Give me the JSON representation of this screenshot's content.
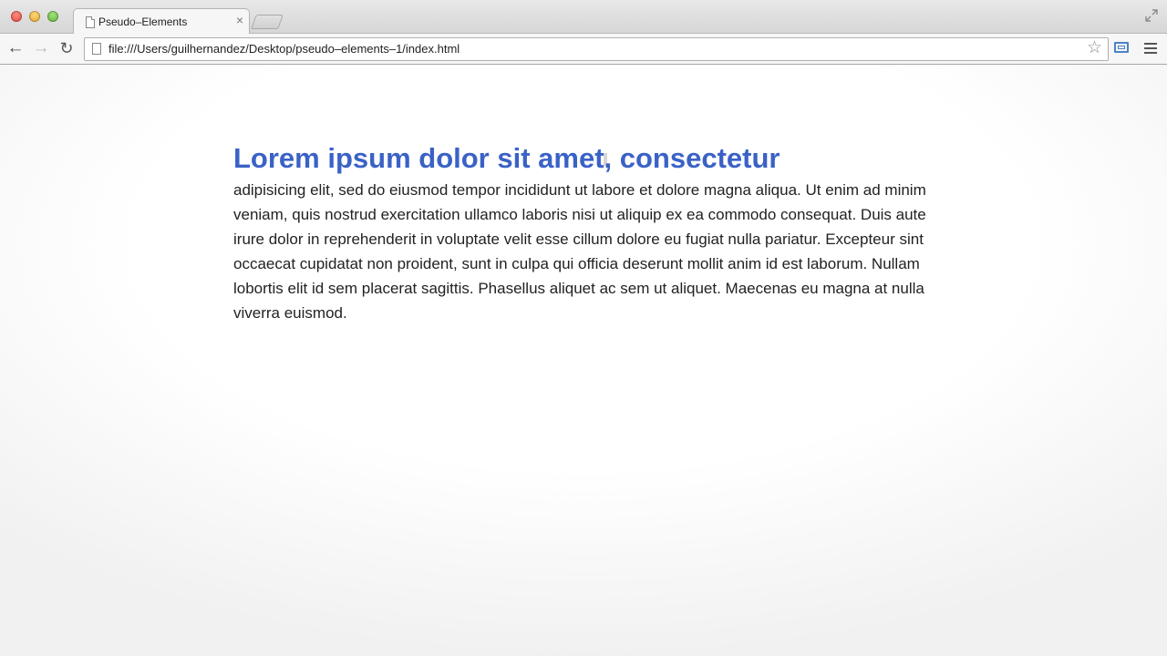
{
  "browser": {
    "tab": {
      "title": "Pseudo–Elements",
      "close_glyph": "×"
    },
    "toolbar": {
      "back_glyph": "←",
      "forward_glyph": "→",
      "reload_glyph": "↻",
      "url": "file:///Users/guilhernandez/Desktop/pseudo–elements–1/index.html",
      "star_glyph": "☆"
    },
    "icons": [
      "close-window-icon",
      "minimize-window-icon",
      "maximize-window-icon",
      "page-icon",
      "fullscreen-icon",
      "back-arrow-icon",
      "forward-arrow-icon",
      "reload-icon",
      "bookmark-star-icon",
      "cast-screen-icon",
      "menu-icon"
    ]
  },
  "page": {
    "headline": "Lorem ipsum dolor sit amet, consectetur",
    "paragraph": "adipisicing elit, sed do eiusmod tempor incididunt ut labore et dolore magna aliqua. Ut enim ad minim veniam, quis nostrud exercitation ullamco laboris nisi ut aliquip ex ea commodo consequat. Duis aute irure dolor in reprehenderit in voluptate velit esse cillum dolore eu fugiat nulla pariatur. Excepteur sint occaecat cupidatat non proident, sunt in culpa qui officia deserunt mollit anim id est laborum. Nullam lobortis elit id sem placerat sagittis. Phasellus aliquet ac sem ut aliquet. Maecenas eu magna at nulla viverra euismod."
  },
  "colors": {
    "headline": "#3a62c6",
    "body_text": "#222222",
    "close_button": "#e0443a",
    "minimize_button": "#dea12a",
    "maximize_button": "#59b336"
  }
}
